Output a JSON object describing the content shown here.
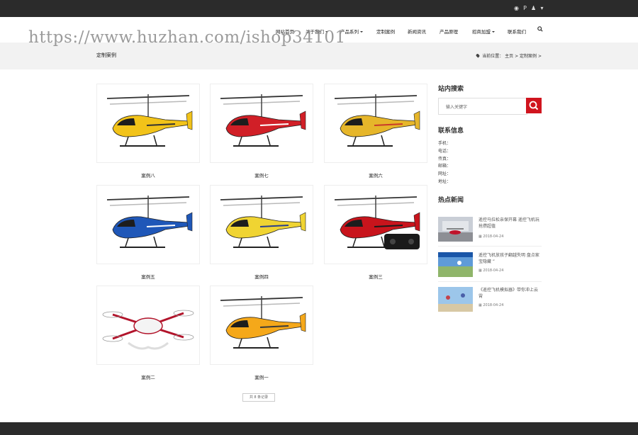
{
  "topbar": {
    "icons": [
      "weibo-icon",
      "paypal-icon",
      "qq-icon",
      "cart-icon"
    ]
  },
  "nav": {
    "items": [
      {
        "label": "网站首页",
        "dropdown": false
      },
      {
        "label": "关于我们",
        "dropdown": true
      },
      {
        "label": "产品系列",
        "dropdown": true
      },
      {
        "label": "定制案例",
        "dropdown": false
      },
      {
        "label": "新闻资讯",
        "dropdown": false
      },
      {
        "label": "产品原理",
        "dropdown": false
      },
      {
        "label": "招商加盟",
        "dropdown": true
      },
      {
        "label": "联系我们",
        "dropdown": false
      }
    ]
  },
  "watermark": "https://www.huzhan.com/ishop34101",
  "banner": {
    "title": "定制案例",
    "breadcrumb_prefix": "当前位置：",
    "breadcrumb_home": "主页",
    "breadcrumb_sep1": ">",
    "breadcrumb_current": "定制案例",
    "breadcrumb_sep2": ">"
  },
  "cases": [
    {
      "label": "案例八",
      "body": "#f2c319",
      "accent": "#333333"
    },
    {
      "label": "案例七",
      "body": "#d11f27",
      "accent": "#ffffff"
    },
    {
      "label": "案例六",
      "body": "#e6b62a",
      "accent": "#c93a2a"
    },
    {
      "label": "案例五",
      "body": "#1f57b8",
      "accent": "#ffffff"
    },
    {
      "label": "案例四",
      "body": "#f0d432",
      "accent": "#2a3f8e"
    },
    {
      "label": "案例三",
      "body": "#c8141c",
      "accent": "#1a1a1a"
    },
    {
      "label": "案例二",
      "body": "#ffffff",
      "accent": "#b2142b"
    },
    {
      "label": "案例一",
      "body": "#f5a81a",
      "accent": "#3a3a3a"
    }
  ],
  "pager": "共 8 条记录",
  "sidebar": {
    "search_title": "站内搜索",
    "search_placeholder": "输入关键字",
    "contact_title": "联系信息",
    "contact": [
      "手机：",
      "电话：",
      "传真：",
      "邮箱：",
      "网址：",
      "地址："
    ],
    "news_title": "热点新闻",
    "news": [
      {
        "title": "遥控马拉松亲保开幕 遥控飞机玩抢攒超值",
        "date": "2018-04-24"
      },
      {
        "title": "遥控飞机放孩子翻越失明 盘点家宝隐藏 ”",
        "date": "2018-04-24"
      },
      {
        "title": "《遥控飞机模拟器》带你冲上云霄",
        "date": "2018-04-24"
      }
    ]
  },
  "colors": {
    "topbar": "#2b2b2b",
    "banner": "#f2f2f2",
    "search_button": "#d0141e"
  }
}
